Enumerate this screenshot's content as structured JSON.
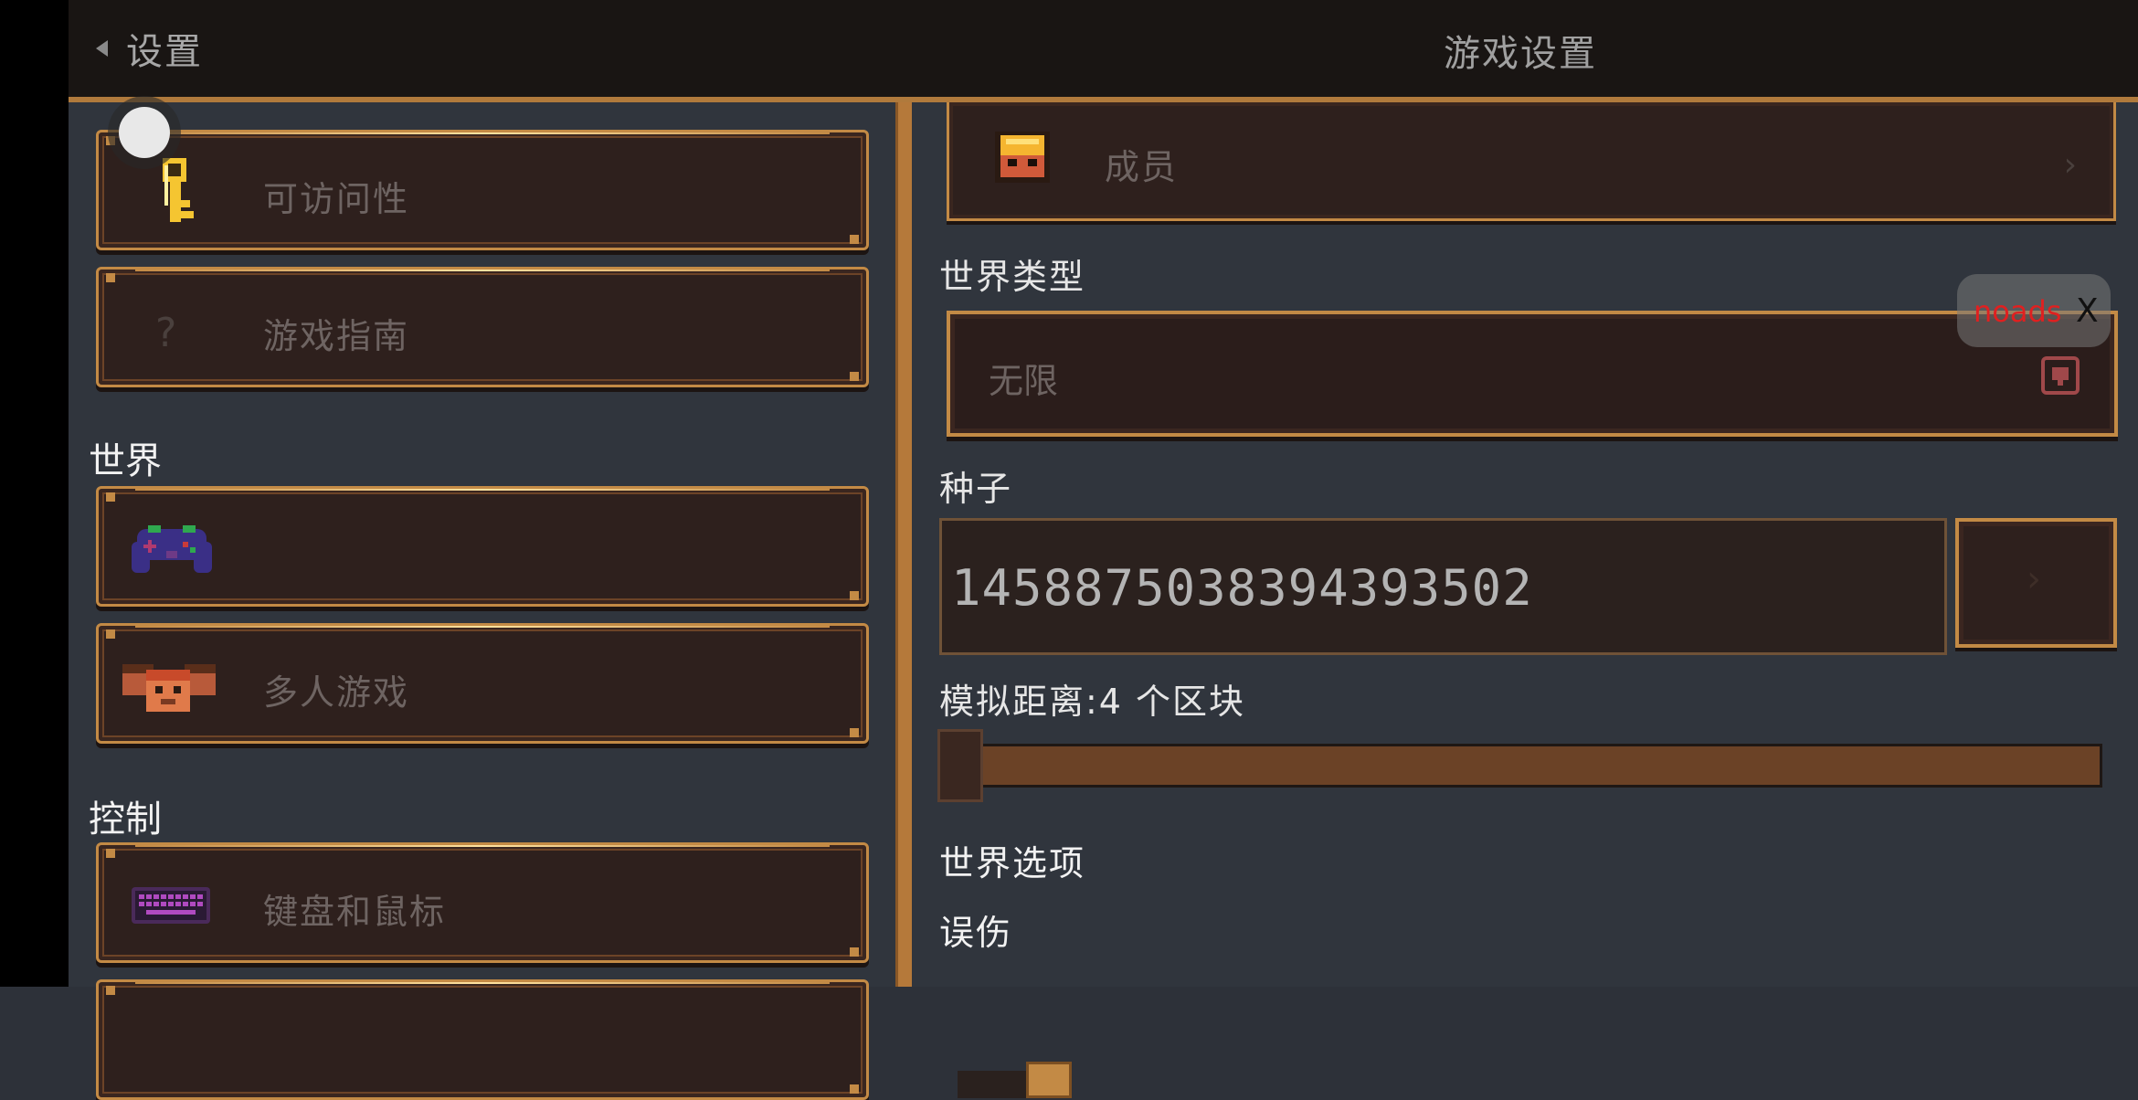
{
  "header": {
    "back_label": "设置",
    "title": "游戏设置"
  },
  "sidebar": {
    "items_top": [
      {
        "label": "可访问性",
        "icon": "key-icon"
      },
      {
        "label": "游戏指南",
        "icon": "question-icon"
      }
    ],
    "sections": [
      {
        "title": "世界",
        "items": [
          {
            "label": "",
            "icon": "gamepad-icon"
          },
          {
            "label": "多人游戏",
            "icon": "players-icon"
          }
        ]
      },
      {
        "title": "控制",
        "items": [
          {
            "label": "键盘和鼠标",
            "icon": "keyboard-icon"
          }
        ]
      }
    ]
  },
  "main": {
    "members_label": "成员",
    "world_type_label": "世界类型",
    "world_type_value": "无限",
    "seed_label": "种子",
    "seed_value": "1458875038394393502",
    "sim_distance_label": "模拟距离:4 个区块",
    "sim_distance_value": 4,
    "world_options_label": "世界选项",
    "friendly_fire_label": "误伤"
  },
  "overlay": {
    "noads_label": "noads",
    "noads_close": "X"
  },
  "colors": {
    "accent": "#c38a45",
    "panel_bg": "#30353d",
    "button_bg": "#2e201d",
    "topbar_bg": "#191513"
  }
}
